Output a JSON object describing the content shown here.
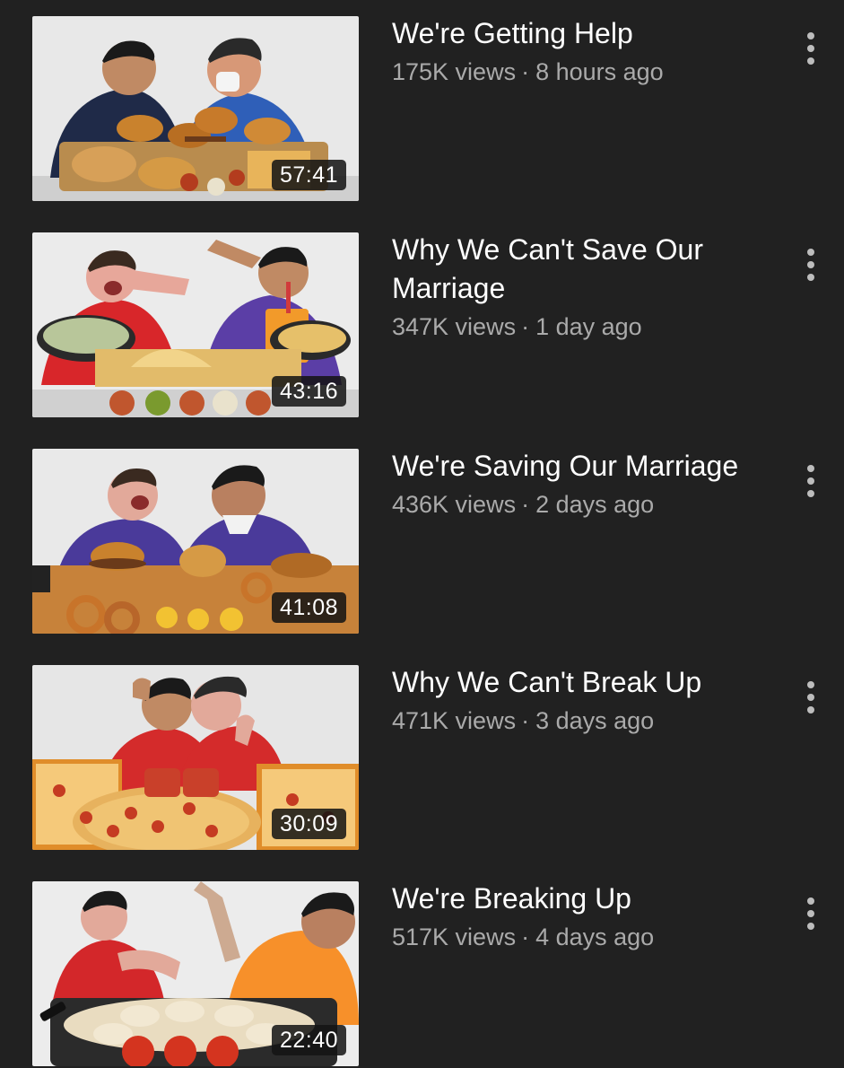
{
  "videos": [
    {
      "title": "We're Getting Help",
      "views": "175K views",
      "age": "8 hours ago",
      "duration": "57:41",
      "thumb_bg": "#e8e8e8",
      "shirt_left": "#1f2a48",
      "shirt_right": "#2f5fb8"
    },
    {
      "title": "Why We Can't Save Our Marriage",
      "views": "347K views",
      "age": "1 day ago",
      "duration": "43:16",
      "thumb_bg": "#ebebeb",
      "shirt_left": "#d8262a",
      "shirt_right": "#5b3ea6"
    },
    {
      "title": "We're Saving Our Marriage",
      "views": "436K views",
      "age": "2 days ago",
      "duration": "41:08",
      "thumb_bg": "#e9e9e9",
      "shirt_left": "#4a3a9a",
      "shirt_right": "#4a3a9a"
    },
    {
      "title": "Why We Can't Break Up",
      "views": "471K views",
      "age": "3 days ago",
      "duration": "30:09",
      "thumb_bg": "#e6e6e6",
      "shirt_left": "#d42b2b",
      "shirt_right": "#d42b2b"
    },
    {
      "title": "We're Breaking Up",
      "views": "517K views",
      "age": "4 days ago",
      "duration": "22:40",
      "thumb_bg": "#ececec",
      "shirt_left": "#d3272a",
      "shirt_right": "#f7902a"
    }
  ],
  "separator": "·",
  "icons": {
    "more": "more-vert-icon"
  }
}
